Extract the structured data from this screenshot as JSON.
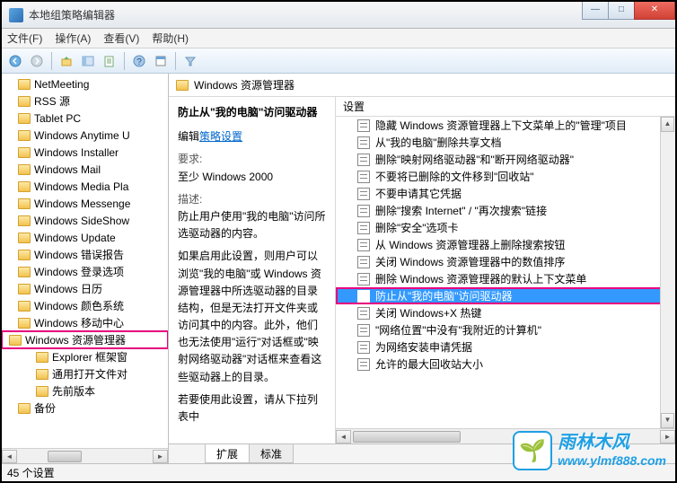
{
  "window": {
    "title": "本地组策略编辑器",
    "min": "—",
    "max": "□",
    "close": "✕"
  },
  "menu": {
    "file": "文件(F)",
    "action": "操作(A)",
    "view": "查看(V)",
    "help": "帮助(H)"
  },
  "tree": {
    "items": [
      {
        "label": "NetMeeting"
      },
      {
        "label": "RSS 源"
      },
      {
        "label": "Tablet PC"
      },
      {
        "label": "Windows Anytime U"
      },
      {
        "label": "Windows Installer"
      },
      {
        "label": "Windows Mail"
      },
      {
        "label": "Windows Media Pla"
      },
      {
        "label": "Windows Messenge"
      },
      {
        "label": "Windows SideShow"
      },
      {
        "label": "Windows Update"
      },
      {
        "label": "Windows 错误报告"
      },
      {
        "label": "Windows 登录选项"
      },
      {
        "label": "Windows 日历"
      },
      {
        "label": "Windows 颜色系统"
      },
      {
        "label": "Windows 移动中心"
      },
      {
        "label": "Windows 资源管理器",
        "highlighted": true
      },
      {
        "label": "Explorer 框架窗",
        "sub": true
      },
      {
        "label": "通用打开文件对",
        "sub": true
      },
      {
        "label": "先前版本",
        "sub": true
      },
      {
        "label": "备份"
      }
    ]
  },
  "breadcrumb": {
    "label": "Windows 资源管理器"
  },
  "desc": {
    "heading": "防止从\"我的电脑\"访问驱动器",
    "edit_prefix": "编辑",
    "edit_link": "策略设置",
    "req_label": "要求:",
    "req_value": "至少 Windows 2000",
    "desc_label": "描述:",
    "desc_p1": "防止用户使用\"我的电脑\"访问所选驱动器的内容。",
    "desc_p2": "如果启用此设置，则用户可以浏览\"我的电脑\"或 Windows 资源管理器中所选驱动器的目录结构，但是无法打开文件夹或访问其中的内容。此外，他们也无法使用\"运行\"对话框或\"映射网络驱动器\"对话框来查看这些驱动器上的目录。",
    "desc_p3": "若要使用此设置，请从下拉列表中"
  },
  "settings": {
    "header": "设置",
    "items": [
      "隐藏 Windows 资源管理器上下文菜单上的\"管理\"项目",
      "从\"我的电脑\"删除共享文档",
      "删除\"映射网络驱动器\"和\"断开网络驱动器\"",
      "不要将已删除的文件移到\"回收站\"",
      "不要申请其它凭据",
      "删除\"搜索 Internet\" / \"再次搜索\"链接",
      "删除\"安全\"选项卡",
      "从 Windows 资源管理器上删除搜索按钮",
      "关闭 Windows 资源管理器中的数值排序",
      "删除 Windows 资源管理器的默认上下文菜单",
      "防止从\"我的电脑\"访问驱动器",
      "关闭 Windows+X 热键",
      "\"网络位置\"中没有\"我附近的计算机\"",
      "为网络安装申请凭据",
      "允许的最大回收站大小"
    ],
    "selected_index": 10
  },
  "tabs": {
    "extended": "扩展",
    "standard": "标准"
  },
  "status": {
    "text": "45 个设置"
  },
  "watermark": {
    "brand": "雨林木风",
    "url": "www.ylmf888.com",
    "emoji": "🌱"
  }
}
